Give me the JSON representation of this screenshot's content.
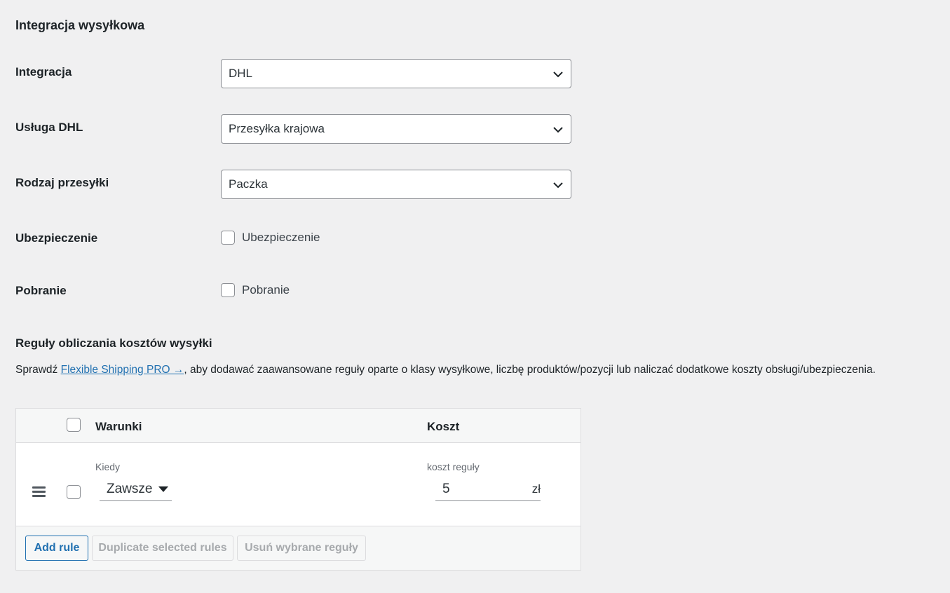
{
  "section": {
    "title": "Integracja wysyłkowa"
  },
  "fields": {
    "integration": {
      "label": "Integracja",
      "value": "DHL"
    },
    "service": {
      "label": "Usługa DHL",
      "value": "Przesyłka krajowa"
    },
    "package_type": {
      "label": "Rodzaj przesyłki",
      "value": "Paczka"
    },
    "insurance": {
      "label": "Ubezpieczenie",
      "checkbox_label": "Ubezpieczenie",
      "checked": false
    },
    "cod": {
      "label": "Pobranie",
      "checkbox_label": "Pobranie",
      "checked": false
    }
  },
  "rules": {
    "title": "Reguły obliczania kosztów wysyłki",
    "description_prefix": "Sprawdź ",
    "link_text": "Flexible Shipping PRO →",
    "description_suffix": ", aby dodawać zaawansowane reguły oparte o klasy wysyłkowe, liczbę produktów/pozycji lub naliczać dodatkowe koszty obsługi/ubezpieczenia.",
    "table": {
      "col_conditions": "Warunki",
      "col_cost": "Koszt",
      "row": {
        "when_label": "Kiedy",
        "when_value": "Zawsze",
        "cost_label": "koszt reguły",
        "cost_value": "5",
        "currency": "zł"
      }
    },
    "buttons": {
      "add": "Add rule",
      "duplicate": "Duplicate selected rules",
      "delete": "Usuń wybrane reguły"
    }
  }
}
